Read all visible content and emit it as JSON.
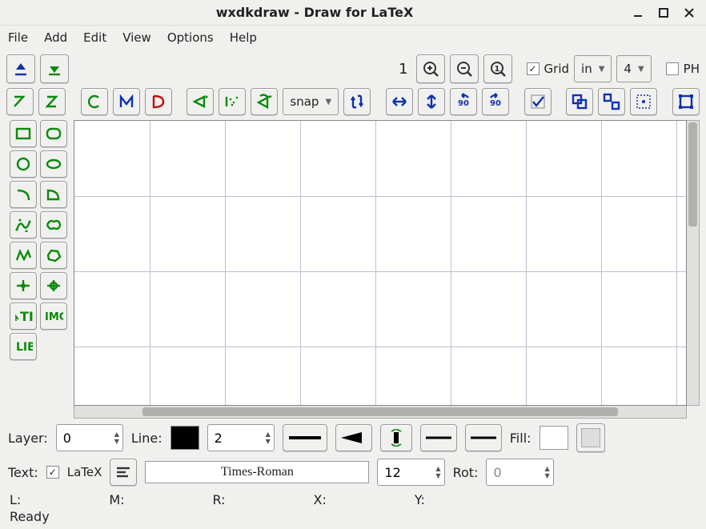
{
  "window": {
    "title": "wxdkdraw - Draw for LaTeX"
  },
  "menu": {
    "file": "File",
    "add": "Add",
    "edit": "Edit",
    "view": "View",
    "options": "Options",
    "help": "Help"
  },
  "top": {
    "zoom_number": "1",
    "grid_cb": true,
    "grid_label": "Grid",
    "unit": "in",
    "subdiv": "4",
    "ph_cb": false,
    "ph_label": "PH",
    "snap_label": "snap"
  },
  "bottom": {
    "layer_label": "Layer:",
    "layer_value": "0",
    "line_label": "Line:",
    "line_value": "2",
    "fill_label": "Fill:",
    "text_label": "Text:",
    "latex_cb": true,
    "latex_label": "LaTeX",
    "font_name": "Times-Roman",
    "font_size": "12",
    "rot_label": "Rot:",
    "rot_value": "0",
    "line_swatch": "#000000",
    "fill_swatch": "#ffffff",
    "fill_swatch2": "#e0e0de"
  },
  "coords": {
    "L": "L:",
    "M": "M:",
    "R": "R:",
    "X": "X:",
    "Y": "Y:"
  },
  "status": "Ready"
}
